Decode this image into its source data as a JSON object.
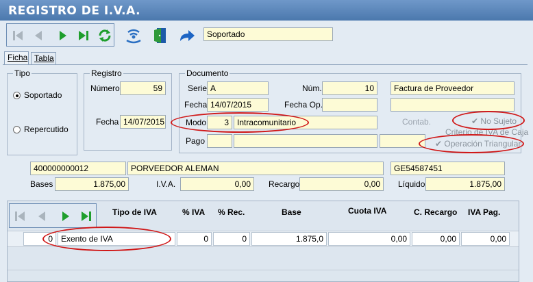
{
  "window": {
    "title": "REGISTRO DE I.V.A."
  },
  "toolbar": {
    "mode_value": "Soportado"
  },
  "tabs": [
    {
      "label": "Ficha"
    },
    {
      "label": "Tabla"
    }
  ],
  "tipo": {
    "title": "Tipo",
    "options": [
      {
        "label": "Soportado",
        "selected": true
      },
      {
        "label": "Repercutido",
        "selected": false
      }
    ]
  },
  "registro": {
    "title": "Registro",
    "numero_label": "Número",
    "numero_value": "59",
    "fecha_label": "Fecha",
    "fecha_value": "14/07/2015"
  },
  "documento": {
    "title": "Documento",
    "serie_label": "Serie",
    "serie_value": "A",
    "num_label": "Núm.",
    "num_value": "10",
    "descripcion_value": "Factura de Proveedor",
    "fecha_label": "Fecha",
    "fecha_value": "14/07/2015",
    "fechaop_label": "Fecha Op.",
    "fechaop_value": "",
    "extra_value": "",
    "modo_label": "Modo",
    "modo_code": "3",
    "modo_value": "Intracomunitario",
    "pago_label": "Pago",
    "pago_code": "",
    "pago_value": "",
    "pago_extra": "",
    "contab_label": "Contab.",
    "no_sujeto_label": "No Sujeto",
    "criterio_label": "Criterio de IVA de Caja",
    "triangular_label": "Operación Triangular"
  },
  "proveedor": {
    "code": "400000000012",
    "name": "PORVEEDOR ALEMAN",
    "nif": "GE54587451"
  },
  "totales": {
    "bases_label": "Bases",
    "bases_value": "1.875,00",
    "iva_label": "I.V.A.",
    "iva_value": "0,00",
    "recargo_label": "Recargo",
    "recargo_value": "0,00",
    "liquido_label": "Líquido",
    "liquido_value": "1.875,00"
  },
  "grid": {
    "headers": [
      "Tipo de IVA",
      "% IVA",
      "% Rec.",
      "Base",
      "Cuota IVA",
      "C. Recargo",
      "IVA Pag."
    ],
    "row": {
      "code": "0",
      "tipo": "Exento de IVA",
      "piva": "0",
      "prec": "0",
      "base": "1.875,0",
      "cuota": "0,00",
      "crecargo": "0,00",
      "ivapag": "0,00"
    }
  },
  "colors": {
    "title_bar": "#4b78ad",
    "nav_green": "#1e9e2c",
    "nav_disabled": "#aab4bd",
    "annotation": "#d01818",
    "field_bg": "#fdfbd6"
  }
}
